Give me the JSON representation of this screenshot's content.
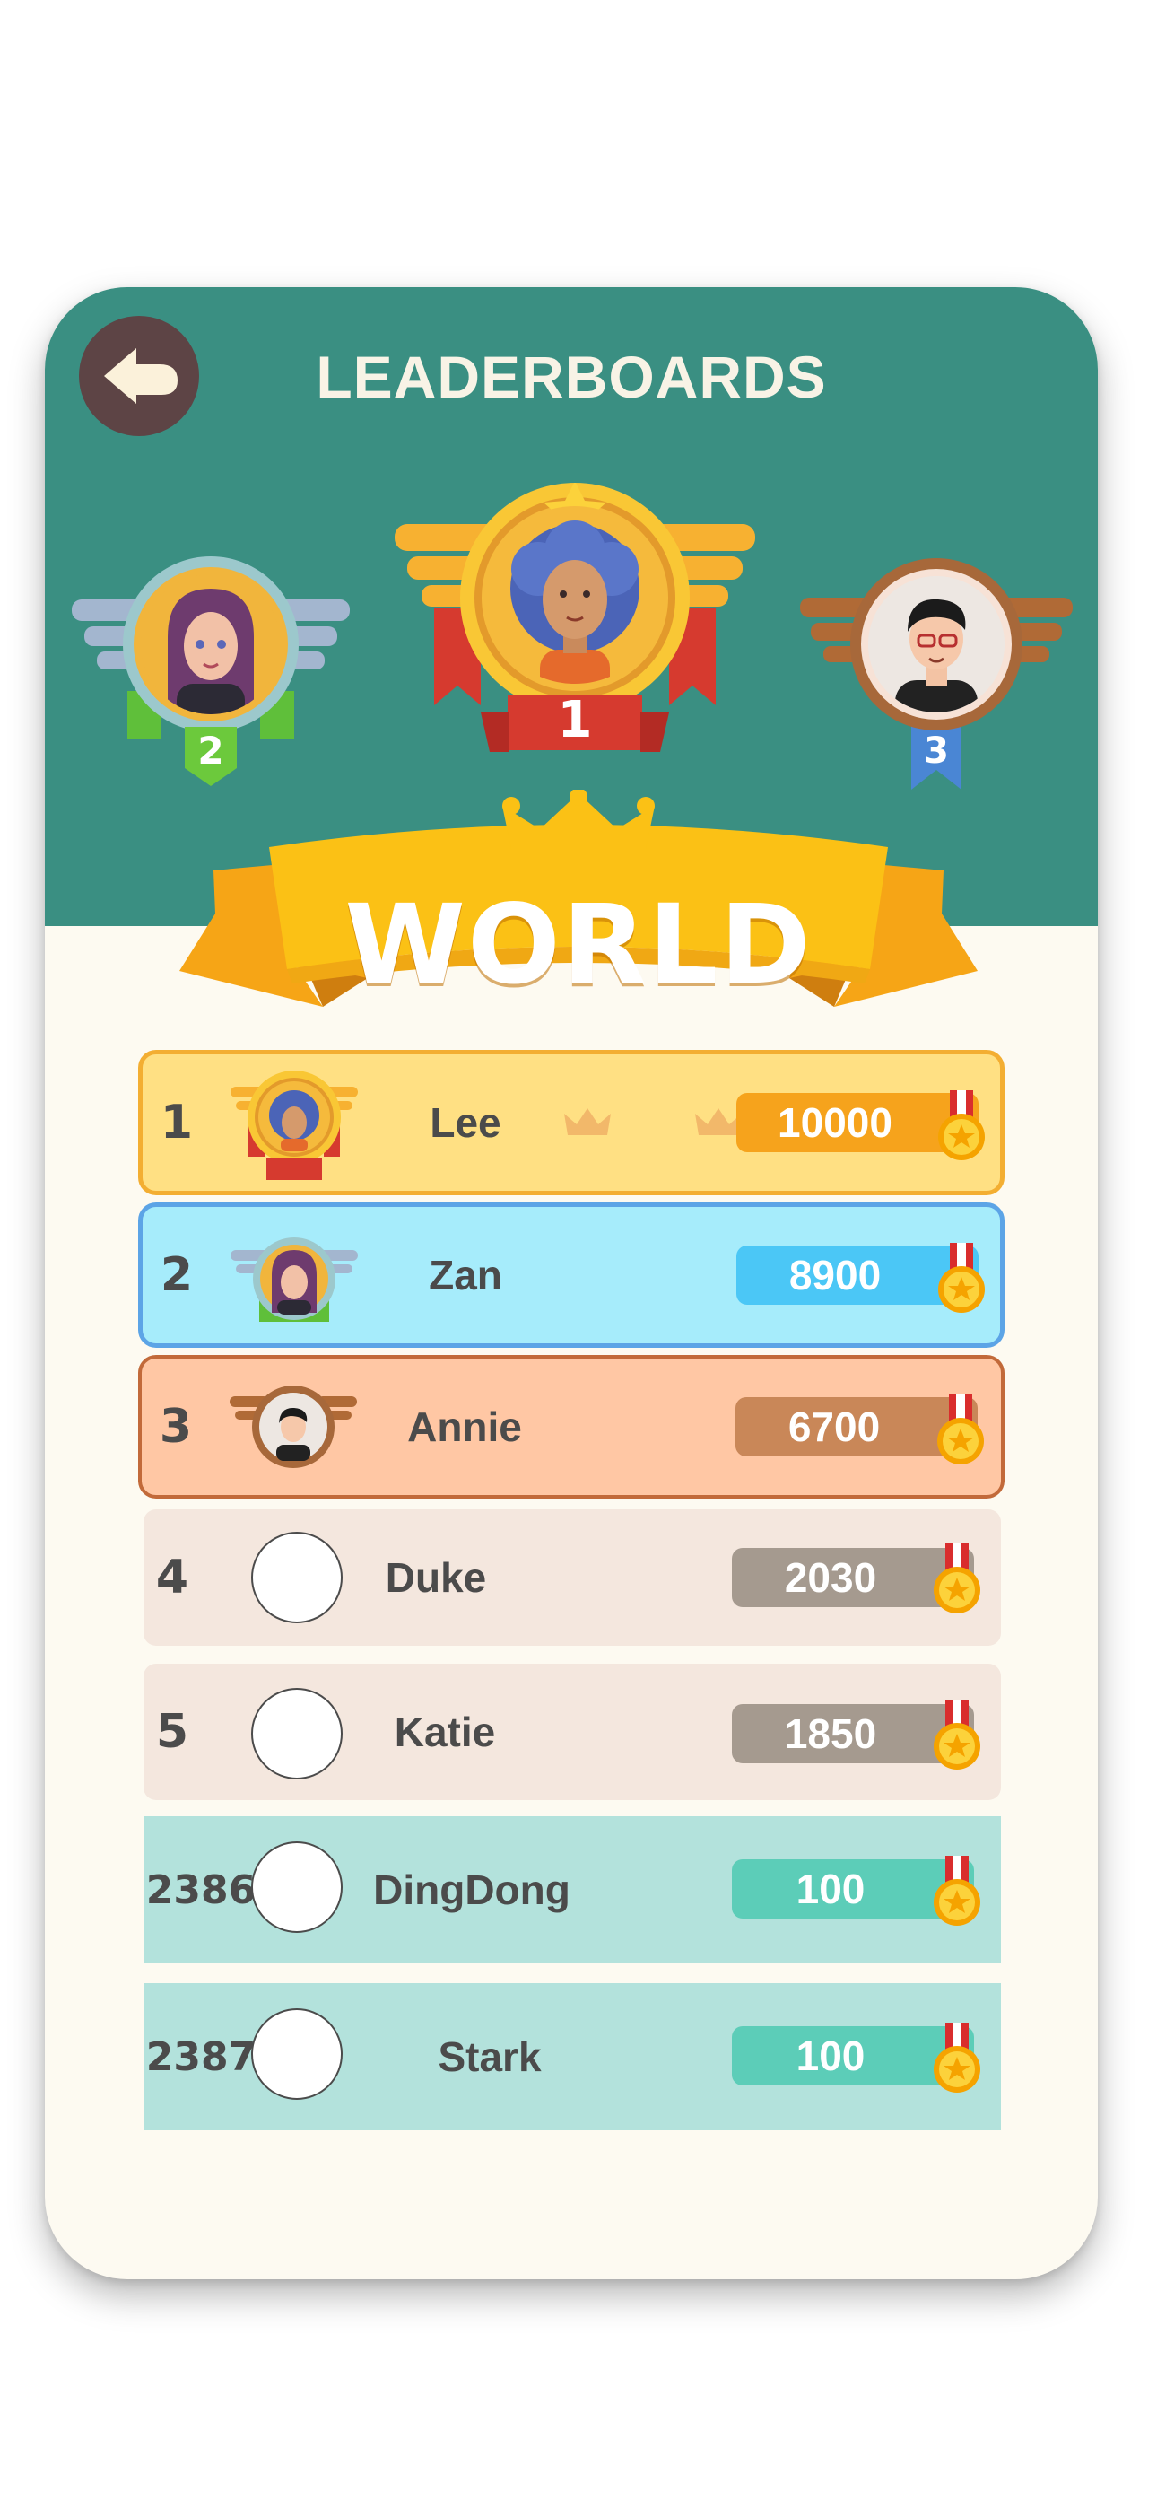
{
  "header": {
    "title": "LEADERBOARDS",
    "back_icon": "arrow-left-icon",
    "color": "#3a8f82"
  },
  "podium": [
    {
      "place": "1",
      "name": "Lee"
    },
    {
      "place": "2",
      "name": "Zan"
    },
    {
      "place": "3",
      "name": "Annie"
    }
  ],
  "banner": {
    "label": "WORLD",
    "icon": "crown-icon"
  },
  "leaderboard": [
    {
      "rank": "1",
      "name": "Lee",
      "score": "10000",
      "style": "gold"
    },
    {
      "rank": "2",
      "name": "Zan",
      "score": "8900",
      "style": "blue"
    },
    {
      "rank": "3",
      "name": "Annie",
      "score": "6700",
      "style": "bronze"
    },
    {
      "rank": "4",
      "name": "Duke",
      "score": "2030",
      "style": "plain"
    },
    {
      "rank": "5",
      "name": "Katie",
      "score": "1850",
      "style": "plain"
    },
    {
      "rank": "2386",
      "name": "DingDong",
      "score": "100",
      "style": "teal"
    },
    {
      "rank": "2387",
      "name": "Stark",
      "score": "100",
      "style": "teal"
    }
  ],
  "colors": {
    "gold": "#ffe083",
    "blue": "#a6ecfb",
    "bronze": "#ffc7a4",
    "plain": "#f4e7de",
    "teal": "#b3e2dc"
  }
}
